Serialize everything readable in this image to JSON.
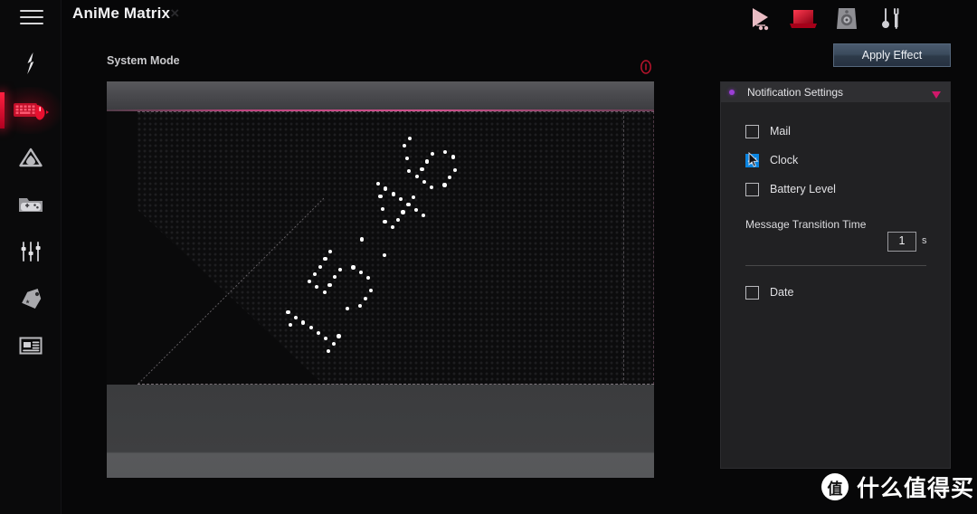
{
  "app": {
    "title": "AniMe Matrix",
    "menu_icon": "hamburger-icon"
  },
  "sidebar": {
    "items": [
      {
        "icon": "rog-logo-icon",
        "label": "ROG",
        "active": false
      },
      {
        "icon": "keyboard-mouse-icon",
        "label": "Lighting",
        "active": true
      },
      {
        "icon": "aura-triangle-icon",
        "label": "Aura Sync",
        "active": false
      },
      {
        "icon": "gamepad-folder-icon",
        "label": "Game Library",
        "active": false
      },
      {
        "icon": "sliders-icon",
        "label": "Settings",
        "active": false
      },
      {
        "icon": "tag-icon",
        "label": "Deals",
        "active": false
      },
      {
        "icon": "window-article-icon",
        "label": "News",
        "active": false
      }
    ]
  },
  "toolbar": {
    "icons": [
      {
        "name": "play-cursor-icon",
        "label": "Preview"
      },
      {
        "name": "laptop-icon",
        "label": "Laptop"
      },
      {
        "name": "speaker-icon",
        "label": "Speaker"
      },
      {
        "name": "tools-icon",
        "label": "Tools"
      }
    ],
    "apply_effect_label": "Apply Effect"
  },
  "main": {
    "section_label": "System Mode",
    "info_icon": "info-icon",
    "preview": {
      "display_name": "anime-matrix-preview",
      "clock_text": "15:46",
      "rotation_deg": -55
    }
  },
  "right_panel": {
    "header_title": "Notification Settings",
    "header_dot_color": "#9b3fd6",
    "collapse_icon": "triangle-down-icon",
    "collapse_icon_color": "#d0186a",
    "checkboxes": [
      {
        "label": "Mail",
        "checked": false
      },
      {
        "label": "Clock",
        "checked": true
      },
      {
        "label": "Battery Level",
        "checked": false
      }
    ],
    "transition": {
      "label": "Message Transition Time",
      "value": "1",
      "unit": "s"
    },
    "date_checkbox": {
      "label": "Date",
      "checked": false
    }
  },
  "watermark": {
    "logo_char": "值",
    "text": "什么值得买"
  },
  "colors": {
    "accent_red": "#d0182f",
    "checkbox_blue": "#0a84e0",
    "panel_bg": "#212123",
    "window_bg": "#070708",
    "magenta_edge": "#d0518c"
  }
}
